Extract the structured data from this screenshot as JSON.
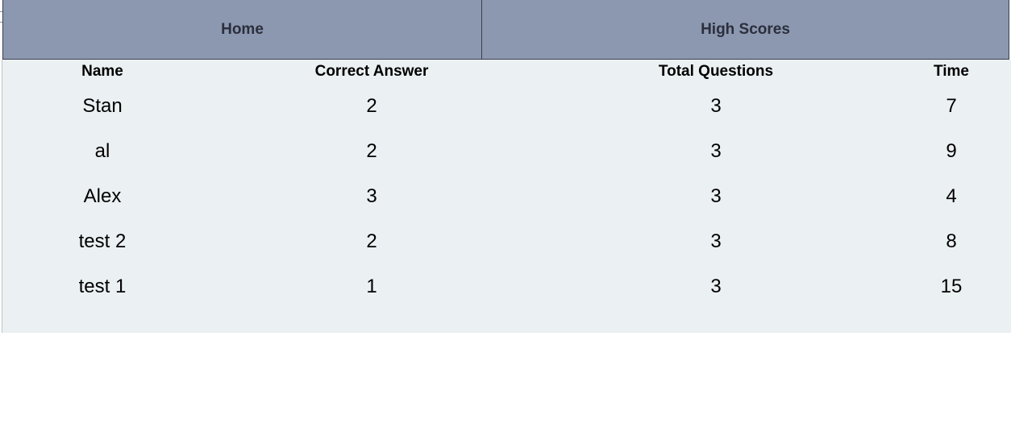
{
  "nav": {
    "home_label": "Home",
    "high_scores_label": "High Scores"
  },
  "table": {
    "headers": [
      "Name",
      "Correct Answer",
      "Total Questions",
      "Time"
    ],
    "rows": [
      [
        "Stan",
        "2",
        "3",
        "7"
      ],
      [
        "al",
        "2",
        "3",
        "9"
      ],
      [
        "Alex",
        "3",
        "3",
        "4"
      ],
      [
        "test 2",
        "2",
        "3",
        "8"
      ],
      [
        "test 1",
        "1",
        "3",
        "15"
      ]
    ]
  },
  "colors": {
    "nav_background": "#8c98b0",
    "nav_text": "#2b2f3d",
    "panel_background": "#ebf0f2"
  }
}
